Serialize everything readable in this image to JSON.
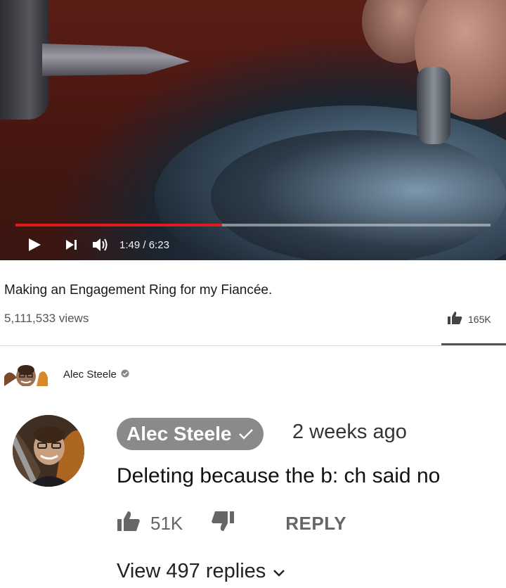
{
  "video": {
    "progress_fraction": 0.435,
    "current_time": "1:49",
    "duration_sep": "/",
    "duration": "6:23",
    "title": "Making an Engagement Ring for my Fiancée.",
    "views": "5,111,533 views",
    "like_count": "165K"
  },
  "channel": {
    "name": "Alec Steele"
  },
  "comment": {
    "author": "Alec Steele",
    "time": "2 weeks ago",
    "text": "Deleting because the b: ch said no",
    "like_count": "51K",
    "reply_label": "REPLY",
    "view_replies": "View 497 replies"
  },
  "colors": {
    "progress_red": "#e01b1b",
    "author_pill": "#8a8a8a"
  }
}
